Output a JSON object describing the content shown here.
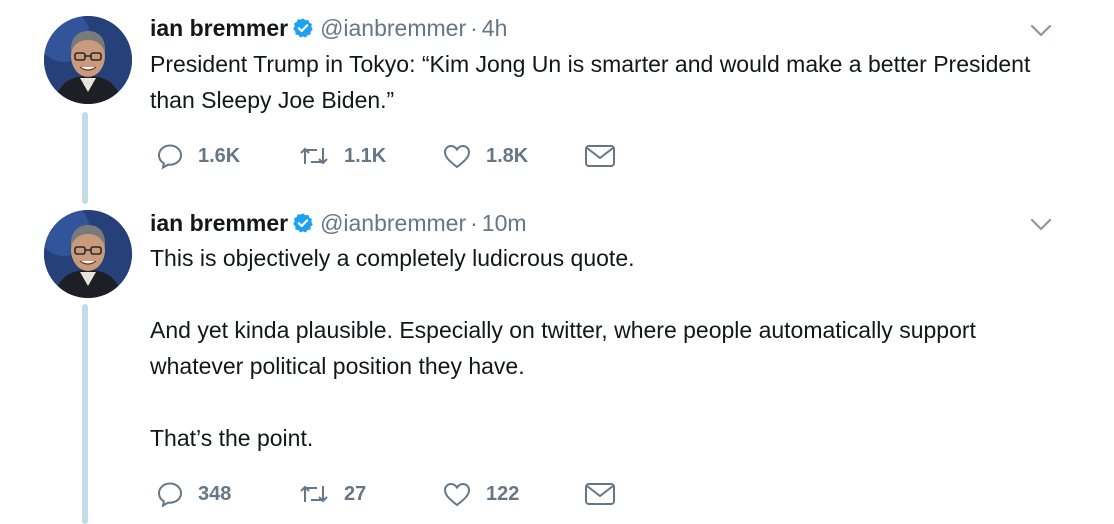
{
  "tweets": [
    {
      "name": "ian bremmer",
      "handle": "@ianbremmer",
      "separator": "·",
      "time": "4h",
      "paragraphs": [
        "President Trump in Tokyo: “Kim Jong Un is smarter and would make a better President than Sleepy Joe Biden.”"
      ],
      "replies": "1.6K",
      "retweets": "1.1K",
      "likes": "1.8K"
    },
    {
      "name": "ian bremmer",
      "handle": "@ianbremmer",
      "separator": "·",
      "time": "10m",
      "paragraphs": [
        "This is objectively a completely ludicrous quote.",
        "And yet kinda plausible. Especially on twitter, where people automatically support whatever political position they have.",
        "That’s the point."
      ],
      "replies": "348",
      "retweets": "27",
      "likes": "122"
    }
  ],
  "icons": {
    "verified": "verified-badge-icon",
    "caret": "chevron-down-icon",
    "reply": "reply-icon",
    "retweet": "retweet-icon",
    "like": "heart-icon",
    "dm": "envelope-icon"
  },
  "colors": {
    "text": "#14171a",
    "secondary": "#657786",
    "verified": "#1da1f2",
    "thread_line": "#c4dbe8"
  }
}
